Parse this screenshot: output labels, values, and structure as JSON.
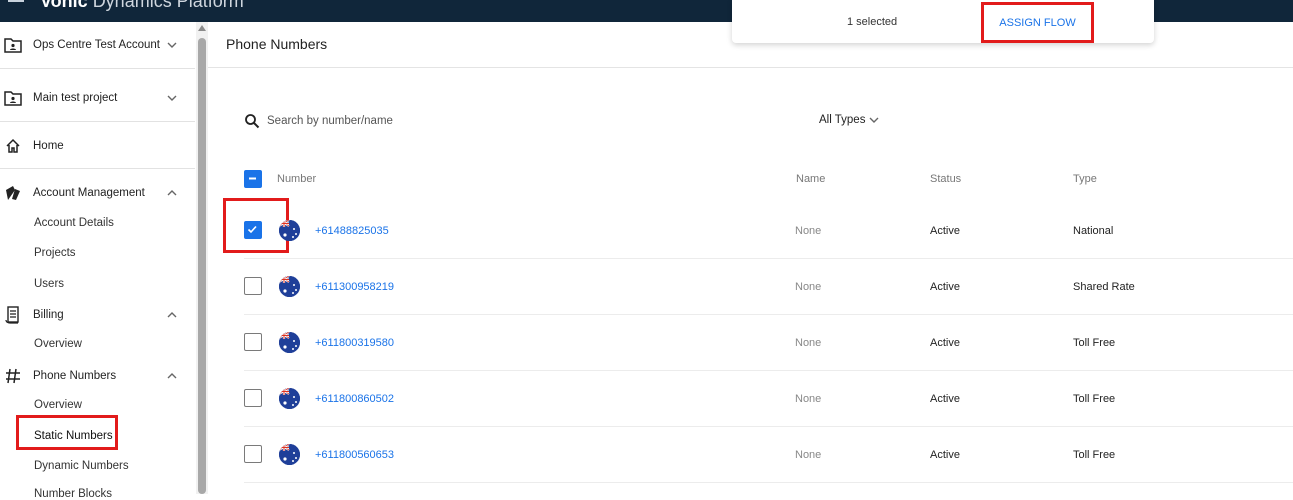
{
  "app": {
    "brand_bold": "Vonic",
    "brand_light": "Dynamics Platform"
  },
  "sidebar": {
    "account": "Ops Centre Test Account",
    "project": "Main test project",
    "home": "Home",
    "account_management": {
      "label": "Account Management",
      "items": [
        "Account Details",
        "Projects",
        "Users"
      ]
    },
    "billing": {
      "label": "Billing",
      "items": [
        "Overview"
      ]
    },
    "phone_numbers": {
      "label": "Phone Numbers",
      "items": [
        "Overview",
        "Static Numbers",
        "Dynamic Numbers",
        "Number Blocks"
      ]
    }
  },
  "page": {
    "title": "Phone Numbers"
  },
  "search": {
    "placeholder": "Search by number/name"
  },
  "filter": {
    "label": "All Types"
  },
  "table": {
    "headers": {
      "number": "Number",
      "name": "Name",
      "status": "Status",
      "type": "Type"
    },
    "rows": [
      {
        "number": "+61488825035",
        "name": "None",
        "status": "Active",
        "type": "National",
        "checked": true
      },
      {
        "number": "+611300958219",
        "name": "None",
        "status": "Active",
        "type": "Shared Rate",
        "checked": false
      },
      {
        "number": "+611800319580",
        "name": "None",
        "status": "Active",
        "type": "Toll Free",
        "checked": false
      },
      {
        "number": "+611800860502",
        "name": "None",
        "status": "Active",
        "type": "Toll Free",
        "checked": false
      },
      {
        "number": "+611800560653",
        "name": "None",
        "status": "Active",
        "type": "Toll Free",
        "checked": false
      }
    ]
  },
  "selection_bar": {
    "count_text": "1 selected",
    "assign_label": "ASSIGN FLOW"
  },
  "colors": {
    "accent": "#1a73e8",
    "highlight": "#e21b1b",
    "topbar": "#10263a"
  }
}
